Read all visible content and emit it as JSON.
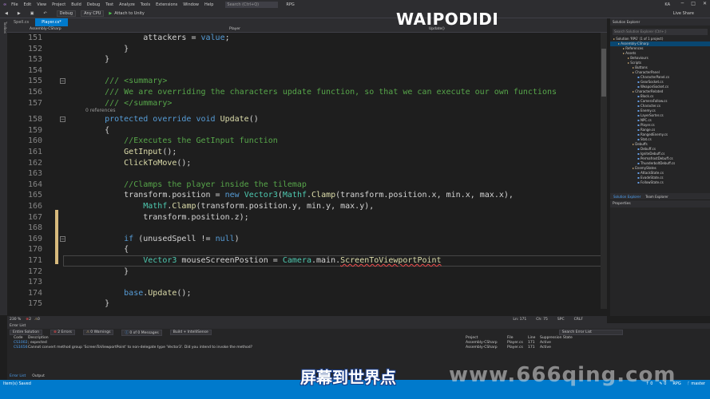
{
  "menubar": {
    "items": [
      "File",
      "Edit",
      "View",
      "Project",
      "Build",
      "Debug",
      "Test",
      "Analyze",
      "Tools",
      "Extensions",
      "Window",
      "Help"
    ],
    "search_placeholder": "Search (Ctrl+Q)",
    "project": "RPG",
    "user": "KA"
  },
  "toolbar": {
    "config": "Debug",
    "platform": "Any CPU",
    "attach": "Attach to Unity",
    "live_share": "Live Share"
  },
  "left_strip": "Toolbox",
  "tabs": [
    {
      "label": "Spell.cs",
      "active": false
    },
    {
      "label": "Player.cs*",
      "active": true
    }
  ],
  "navbar": {
    "project": "Assembly-CSharp",
    "class": "Player",
    "member": "Update()"
  },
  "code_lines": [
    {
      "n": "151",
      "html": "<span class=\"pl\">            attackers = </span><span class=\"kw\">value</span><span class=\"pl\">;</span>"
    },
    {
      "n": "152",
      "html": "<span class=\"pl\">        }</span>"
    },
    {
      "n": "153",
      "html": "<span class=\"pl\">    }</span>"
    },
    {
      "n": "154",
      "html": ""
    },
    {
      "n": "155",
      "html": "<span class=\"cm\">    /// &lt;summary&gt;</span>"
    },
    {
      "n": "156",
      "html": "<span class=\"cm\">    /// We are overriding the characters update function, so that we can execute our own functions</span>"
    },
    {
      "n": "157",
      "html": "<span class=\"cm\">    /// &lt;/summary&gt;</span>"
    },
    {
      "n": "158",
      "html": "<span class=\"kw\">    protected override void </span><span class=\"fn\">Update</span><span class=\"pl\">()</span>"
    },
    {
      "n": "159",
      "html": "<span class=\"pl\">    {</span>"
    },
    {
      "n": "160",
      "html": "<span class=\"cm\">        //Executes the GetInput function</span>"
    },
    {
      "n": "161",
      "html": "<span class=\"fn\">        GetInput</span><span class=\"pl\">();</span>"
    },
    {
      "n": "162",
      "html": "<span class=\"fn\">        ClickToMove</span><span class=\"pl\">();</span>"
    },
    {
      "n": "163",
      "html": ""
    },
    {
      "n": "164",
      "html": "<span class=\"cm\">        //Clamps the player inside the tilemap</span>"
    },
    {
      "n": "165",
      "html": "<span class=\"pl\">        transform.position = </span><span class=\"kw\">new </span><span class=\"ty\">Vector3</span><span class=\"pl\">(</span><span class=\"ty\">Mathf</span><span class=\"pl\">.</span><span class=\"fn\">Clamp</span><span class=\"pl\">(transform.position.x, min.x, max.x),</span>"
    },
    {
      "n": "166",
      "html": "<span class=\"pl\">            </span><span class=\"ty\">Mathf</span><span class=\"pl\">.</span><span class=\"fn\">Clamp</span><span class=\"pl\">(transform.position.y, min.y, max.y),</span>"
    },
    {
      "n": "167",
      "html": "<span class=\"pl\">            transform.position.z);</span>"
    },
    {
      "n": "168",
      "html": ""
    },
    {
      "n": "169",
      "html": "<span class=\"kw\">        if </span><span class=\"pl\">(unusedSpell != </span><span class=\"kw\">null</span><span class=\"pl\">)</span>"
    },
    {
      "n": "170",
      "html": "<span class=\"pl\">        {</span>"
    },
    {
      "n": "171",
      "html": "<span class=\"ty\">            Vector3 </span><span class=\"pl\">mouseScreenPostion = </span><span class=\"ty\">Camera</span><span class=\"pl\">.main.</span><span class=\"fn squig\">ScreenToViewportPoint</span>"
    },
    {
      "n": "172",
      "html": "<span class=\"pl\">        }</span>"
    },
    {
      "n": "173",
      "html": ""
    },
    {
      "n": "174",
      "html": "<span class=\"kw\">        base</span><span class=\"pl\">.</span><span class=\"fn\">Update</span><span class=\"pl\">();</span>"
    },
    {
      "n": "175",
      "html": "<span class=\"pl\">    }</span>"
    },
    {
      "n": "176",
      "html": ""
    }
  ],
  "references_label": "0 references",
  "editor_status": {
    "zoom": "230 %",
    "errors": "2",
    "warnings": "0",
    "line": "Ln: 171",
    "col": "Ch: 75",
    "spc": "SPC",
    "eol": "CRLF"
  },
  "solution_explorer": {
    "title": "Solution Explorer",
    "search_placeholder": "Search Solution Explorer (Ctrl+;)",
    "items": [
      {
        "text": "Solution 'RPG' (1 of 1 project)",
        "indent": 0,
        "sel": false
      },
      {
        "text": "Assembly-CSharp",
        "indent": 1,
        "sel": true
      },
      {
        "text": "References",
        "indent": 2,
        "sel": false
      },
      {
        "text": "Assets",
        "indent": 2,
        "sel": false
      },
      {
        "text": "Behaviours",
        "indent": 3,
        "sel": false
      },
      {
        "text": "Scripts",
        "indent": 3,
        "sel": false
      },
      {
        "text": "Buttons",
        "indent": 4,
        "sel": false
      },
      {
        "text": "CharacterPanel",
        "indent": 4,
        "sel": false
      },
      {
        "text": "CharacterPanel.cs",
        "indent": 5,
        "sel": false
      },
      {
        "text": "GearSocket.cs",
        "indent": 5,
        "sel": false
      },
      {
        "text": "WeaponSocket.cs",
        "indent": 5,
        "sel": false
      },
      {
        "text": "CharacterRelated",
        "indent": 4,
        "sel": false
      },
      {
        "text": "Block.cs",
        "indent": 5,
        "sel": false
      },
      {
        "text": "CameraFollow.cs",
        "indent": 5,
        "sel": false
      },
      {
        "text": "Character.cs",
        "indent": 5,
        "sel": false
      },
      {
        "text": "Enemy.cs",
        "indent": 5,
        "sel": false
      },
      {
        "text": "LayerSorter.cs",
        "indent": 5,
        "sel": false
      },
      {
        "text": "NPC.cs",
        "indent": 5,
        "sel": false
      },
      {
        "text": "Player.cs",
        "indent": 5,
        "sel": false
      },
      {
        "text": "Range.cs",
        "indent": 5,
        "sel": false
      },
      {
        "text": "RangedEnemy.cs",
        "indent": 5,
        "sel": false
      },
      {
        "text": "Stat.cs",
        "indent": 5,
        "sel": false
      },
      {
        "text": "Debuffs",
        "indent": 4,
        "sel": false
      },
      {
        "text": "Debuff.cs",
        "indent": 5,
        "sel": false
      },
      {
        "text": "IgniteDebuff.cs",
        "indent": 5,
        "sel": false
      },
      {
        "text": "PermafrostDebuff.cs",
        "indent": 5,
        "sel": false
      },
      {
        "text": "ThunderboltDebuff.cs",
        "indent": 5,
        "sel": false
      },
      {
        "text": "EnemyStates",
        "indent": 4,
        "sel": false
      },
      {
        "text": "AttackState.cs",
        "indent": 5,
        "sel": false
      },
      {
        "text": "EvadeState.cs",
        "indent": 5,
        "sel": false
      },
      {
        "text": "FollowState.cs",
        "indent": 5,
        "sel": false
      }
    ],
    "tabs": [
      "Solution Explorer",
      "Team Explorer"
    ]
  },
  "properties": {
    "title": "Properties"
  },
  "error_list": {
    "title": "Error List",
    "scope": "Entire Solution",
    "errors_label": "2 Errors",
    "warnings_label": "0 Warnings",
    "messages_label": "0 of 0 Messages",
    "build_filter": "Build + IntelliSense",
    "search_placeholder": "Search Error List",
    "columns": [
      "Code",
      "Description",
      "Project",
      "File",
      "Line",
      "Suppression State"
    ],
    "rows": [
      {
        "code": "CS1002",
        "desc": "; expected",
        "project": "Assembly-CSharp",
        "file": "Player.cs",
        "line": "171",
        "state": "Active"
      },
      {
        "code": "CS1656",
        "desc": "Cannot convert method group 'ScreenToViewportPoint' to non-delegate type 'Vector3'. Did you intend to invoke the method?",
        "project": "Assembly-CSharp",
        "file": "Player.cs",
        "line": "171",
        "state": "Active"
      }
    ]
  },
  "bottom_tabs": [
    "Error List",
    "Output"
  ],
  "statusbar": {
    "left": "Item(s) Saved",
    "right_items": [
      "↑ 0",
      "✎ 0",
      "RPG",
      "ᚴ master"
    ]
  },
  "overlay": {
    "channel_watermark": "WAIPODIDI",
    "subtitle": "屏幕到世界点",
    "site_watermark": "www.666qing.com"
  }
}
